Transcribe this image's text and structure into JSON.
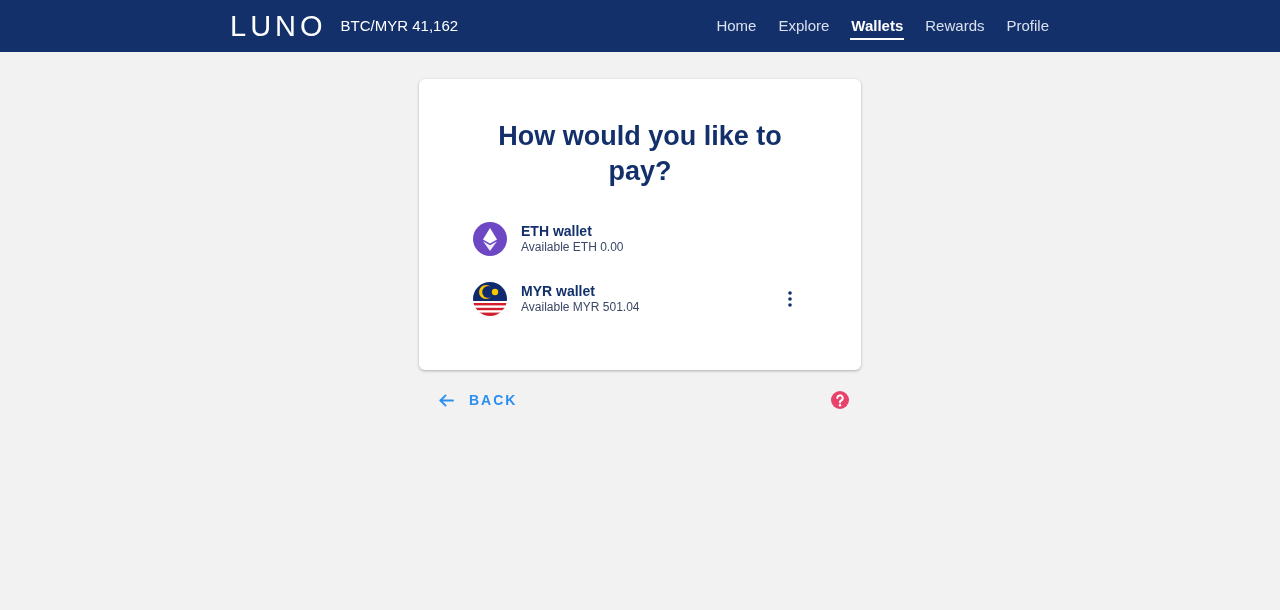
{
  "header": {
    "logo": "LUNO",
    "ticker": "BTC/MYR 41,162",
    "nav": [
      {
        "label": "Home",
        "selected": false
      },
      {
        "label": "Explore",
        "selected": false
      },
      {
        "label": "Wallets",
        "selected": true
      },
      {
        "label": "Rewards",
        "selected": false
      },
      {
        "label": "Profile",
        "selected": false
      }
    ]
  },
  "card": {
    "title": "How would you like to pay?",
    "wallets": [
      {
        "kind": "eth",
        "name": "ETH wallet",
        "balance": "Available ETH 0.00",
        "menu": false
      },
      {
        "kind": "myr",
        "name": "MYR wallet",
        "balance": "Available MYR 501.04",
        "menu": true
      }
    ]
  },
  "footer": {
    "back": "BACK"
  }
}
